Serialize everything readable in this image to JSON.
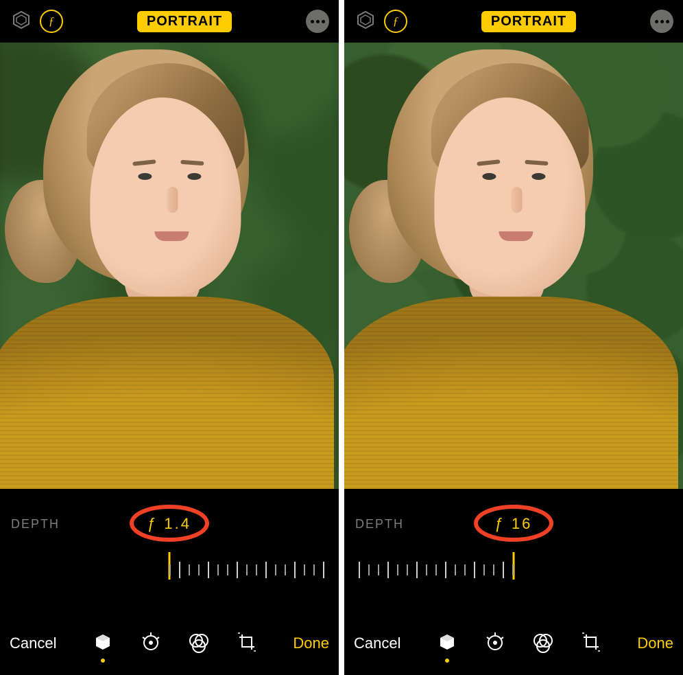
{
  "left": {
    "topbar": {
      "mode_badge": "PORTRAIT",
      "f_button_glyph": "ƒ"
    },
    "depth": {
      "label": "DEPTH",
      "f_value": "ƒ 1.4"
    },
    "bottom": {
      "cancel": "Cancel",
      "done": "Done"
    }
  },
  "right": {
    "topbar": {
      "mode_badge": "PORTRAIT",
      "f_button_glyph": "ƒ"
    },
    "depth": {
      "label": "DEPTH",
      "f_value": "ƒ 16"
    },
    "bottom": {
      "cancel": "Cancel",
      "done": "Done"
    }
  },
  "icons": {
    "lighting": "lighting-hexagon-icon",
    "aperture": "aperture-f-icon",
    "more": "more-icon",
    "cube": "portrait-lighting-icon",
    "adjust": "adjust-dial-icon",
    "filters": "filters-icon",
    "crop": "crop-icon"
  },
  "colors": {
    "accent": "#ffcc00",
    "annotation": "#f04025"
  }
}
